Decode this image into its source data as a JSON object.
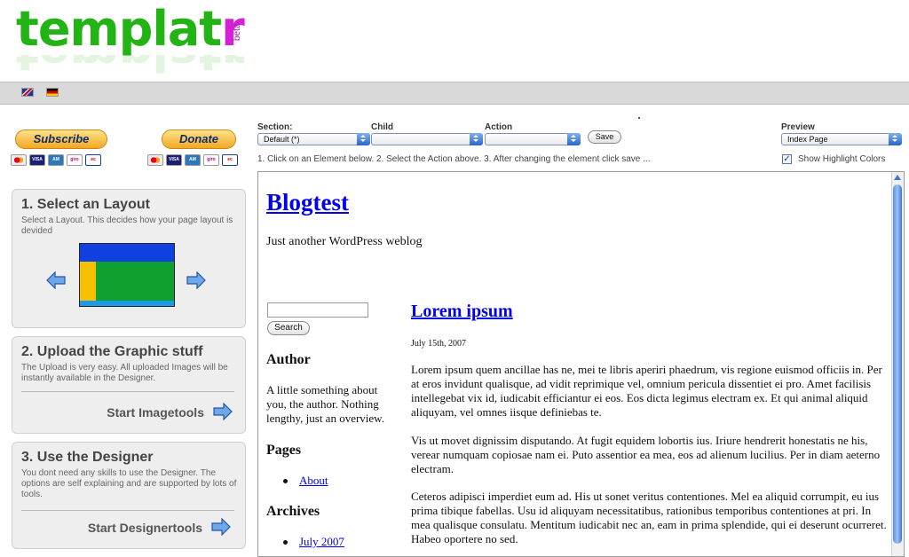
{
  "header": {
    "logo_text": "templatr",
    "logo_badge": "beta",
    "languages": [
      "English",
      "Deutsch"
    ]
  },
  "payments": {
    "subscribe_label": "Subscribe",
    "donate_label": "Donate",
    "card_icons": [
      "mastercard-icon",
      "visa-icon",
      "amex-icon",
      "giropay-icon",
      "ec-icon"
    ]
  },
  "steps": [
    {
      "title": "1. Select an Layout",
      "description": "Select a Layout. This decides how your page layout is devided"
    },
    {
      "title": "2. Upload the Graphic stuff",
      "description": "The Upload is very easy. All uploaded Images will be instantly available in the Designer.",
      "link": "Start Imagetools"
    },
    {
      "title": "3. Use the Designer",
      "description": "You dont need any skills to use the Designer. The options are self explaining and are supported by lots of tools.",
      "link": "Start Designertools"
    }
  ],
  "toolbar": {
    "section_label": "Section:",
    "section_value": "Default (*)",
    "child_label": "Child",
    "child_value": "",
    "action_label": "Action",
    "action_value": "",
    "save_label": "Save",
    "preview_label": "Preview",
    "preview_value": "Index Page",
    "instructions": "1. Click on an Element below. 2. Select the Action above. 3. After changing the element click save ...",
    "highlight_label": "Show Highlight Colors",
    "highlight_checked": true
  },
  "preview": {
    "blog_title": "Blogtest",
    "tagline": "Just another WordPress weblog",
    "search_button": "Search",
    "author_heading": "Author",
    "author_text": "A little something about you, the author. Nothing lengthy, just an overview.",
    "pages_heading": "Pages",
    "pages": [
      "About"
    ],
    "archives_heading": "Archives",
    "archives": [
      "July 2007"
    ],
    "post": {
      "title": "Lorem ipsum",
      "date": "July 15th, 2007",
      "paragraphs": [
        "Lorem ipsum quem ancillae has ne, mei te libris aperiri phaedrum, vis regione euismod officiis in. Per at eros invidunt qualisque, ad vidit reprimique vel, omnium pericula dissentiet ei pro. Amet facilisis intellegebat vix id, iudicabit efficiantur ei eos. Eos dicta legimus electram ex. Et qui animal aliquid aliquyam, vel omnes iisque definiebas te.",
        "Vis ut movet dignissim disputando. At fugit equidem lobortis ius. Iriure hendrerit honestatis ne his, verear numquam copiosae nam ei. Puto assentior ea mea, eos ad alienum lucilius. Per in diam aeterno electram.",
        "Ceteros adipisci imperdiet eum ad. His ut sonet veritus contentiones. Mel ea aliquid corrumpit, eu ius prima tibique fabellas. Usu id aliquyam necessitatibus, rationibus temporibus contentiones at pri. In mea qualisque consulatu. Mentitum iudicabit nec an, eam in prima splendide, qui ei deserunt ocurreret. Habeo oportere no sed."
      ]
    }
  },
  "colors": {
    "logo_green": "#22b314",
    "logo_accent": "#d81fd8",
    "layout_top": "#1040e0",
    "layout_side": "#f5c000",
    "layout_main": "#10a030",
    "layout_footer": "#1a9be8",
    "link_blue": "#0000ee"
  }
}
